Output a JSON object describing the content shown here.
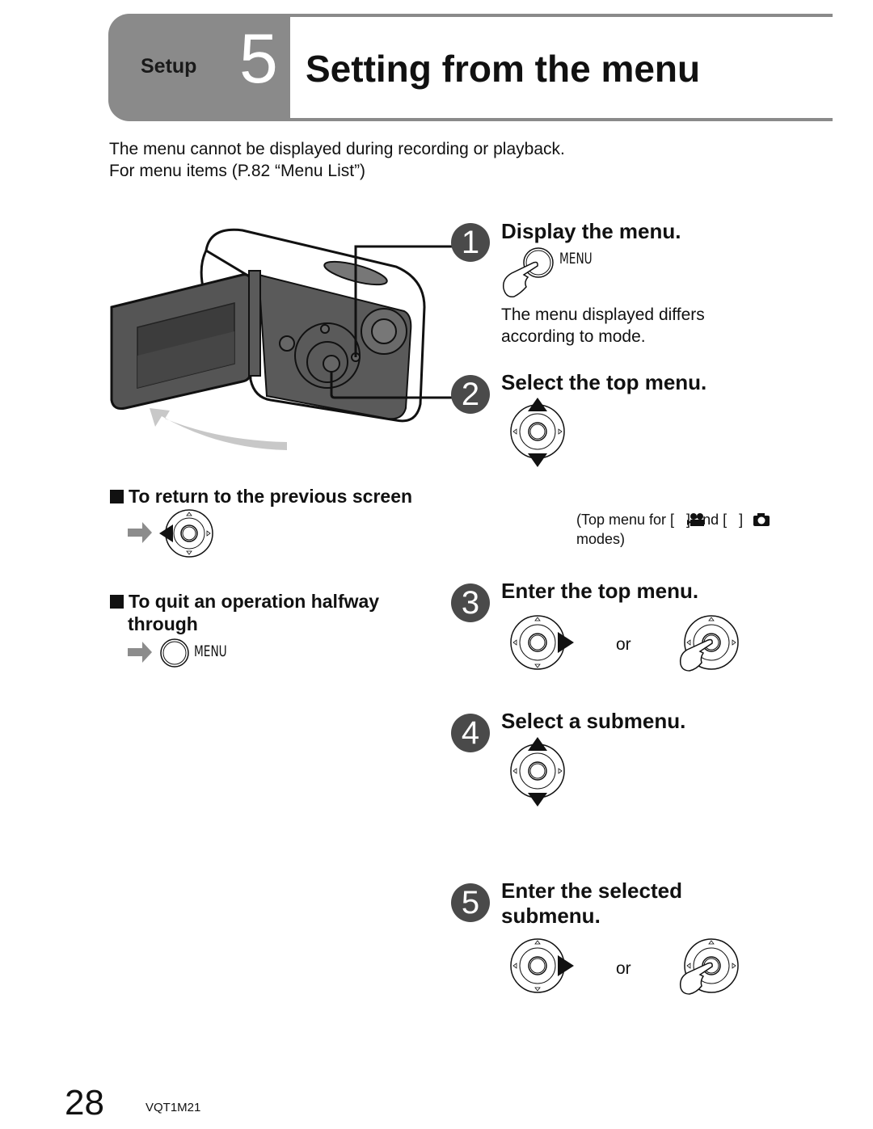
{
  "header": {
    "section_label": "Setup",
    "section_number": "5",
    "title": "Setting from the menu"
  },
  "intro": {
    "line1": "The menu cannot be displayed during recording or playback.",
    "line2": "For menu items (P.82 “Menu List”)"
  },
  "steps": [
    {
      "number": "1",
      "title": "Display the menu.",
      "button_label": "MENU",
      "note": "The menu displayed differs according to mode.",
      "note_line1": "The menu displayed differs",
      "note_line2": "according to mode."
    },
    {
      "number": "2",
      "title": "Select the top menu.",
      "note_line1": "(Top menu for [   ] and [   ]",
      "note_line2": "modes)"
    },
    {
      "number": "3",
      "title": "Enter the top menu.",
      "or_label": "or"
    },
    {
      "number": "4",
      "title": "Select a submenu."
    },
    {
      "number": "5",
      "title_line1": "Enter the selected",
      "title_line2": "submenu.",
      "or_label": "or"
    }
  ],
  "tips": {
    "return": {
      "heading": "To return to the previous screen"
    },
    "quit": {
      "heading_line1": "To quit an operation halfway",
      "heading_line2": "through",
      "button_label": "MENU"
    }
  },
  "icons": {
    "movie_mode": "movie-camera-icon",
    "photo_mode": "still-camera-icon"
  },
  "colors": {
    "header_gray": "#8a8a8a",
    "step_badge": "#4a4a4a",
    "arrow_gray": "#8c8c8c"
  },
  "footer": {
    "page_number": "28",
    "doc_code": "VQT1M21"
  }
}
